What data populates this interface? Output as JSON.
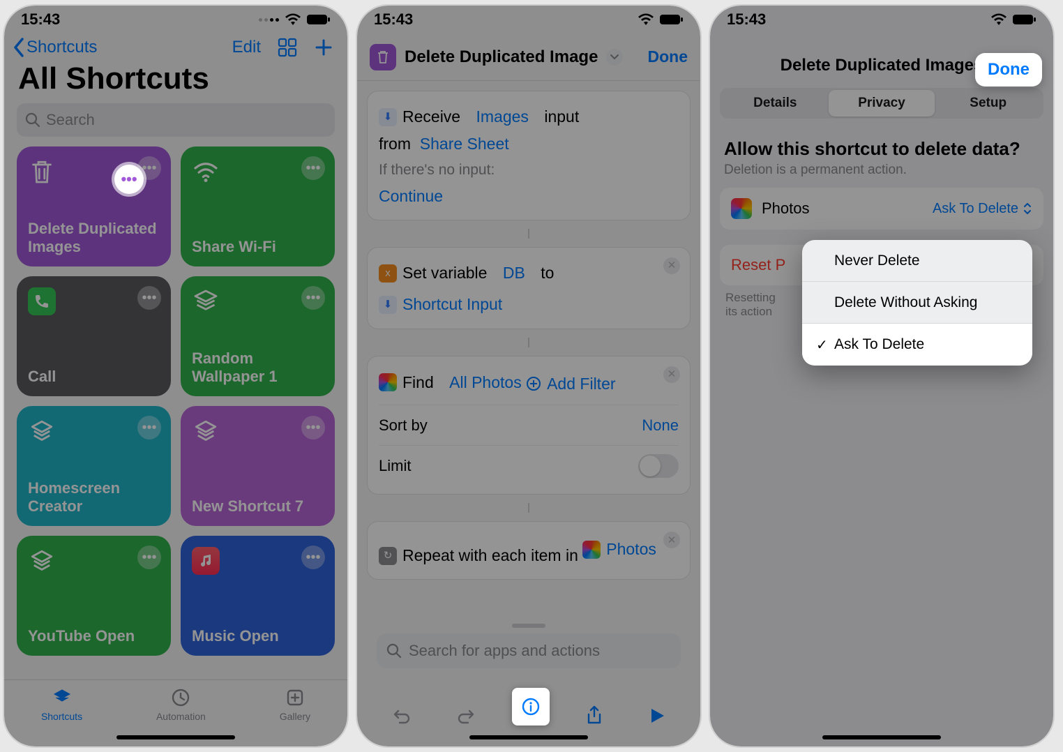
{
  "status": {
    "time": "15:43"
  },
  "screen1": {
    "back": "Shortcuts",
    "edit": "Edit",
    "title": "All Shortcuts",
    "search_placeholder": "Search",
    "tiles": [
      {
        "label": "Delete Duplicated Images",
        "color": "#a259d9"
      },
      {
        "label": "Share Wi-Fi",
        "color": "#2fb14c"
      },
      {
        "label": "Call",
        "color": "#5a5a5e"
      },
      {
        "label": "Random Wallpaper 1",
        "color": "#2fb14c"
      },
      {
        "label": "Homescreen Creator",
        "color": "#1fb6c9"
      },
      {
        "label": "New Shortcut 7",
        "color": "#b566d6"
      },
      {
        "label": "YouTube Open",
        "color": "#2fb14c"
      },
      {
        "label": "Music Open",
        "color": "#2f62d9"
      }
    ],
    "tabs": {
      "shortcuts": "Shortcuts",
      "automation": "Automation",
      "gallery": "Gallery"
    }
  },
  "screen2": {
    "title": "Delete Duplicated Images",
    "done": "Done",
    "receive": "Receive",
    "images_token": "Images",
    "input_word": "input",
    "from": "from",
    "share_sheet": "Share Sheet",
    "if_no_input": "If there's no input:",
    "continue": "Continue",
    "set_variable": "Set variable",
    "db": "DB",
    "to": "to",
    "shortcut_input": "Shortcut Input",
    "find": "Find",
    "all_photos": "All Photos",
    "add_filter": "Add Filter",
    "sort_by": "Sort by",
    "none": "None",
    "limit": "Limit",
    "repeat": "Repeat with each item in",
    "photos": "Photos",
    "search_placeholder": "Search for apps and actions"
  },
  "screen3": {
    "title": "Delete Duplicated Images",
    "done": "Done",
    "tabs": {
      "details": "Details",
      "privacy": "Privacy",
      "setup": "Setup"
    },
    "heading": "Allow this shortcut to delete data?",
    "subheading": "Deletion is a permanent action.",
    "app": "Photos",
    "value": "Ask To Delete",
    "reset": "Reset P",
    "reset_note": "Resetting\nits action",
    "menu": {
      "never": "Never Delete",
      "without": "Delete Without Asking",
      "ask": "Ask To Delete"
    }
  }
}
